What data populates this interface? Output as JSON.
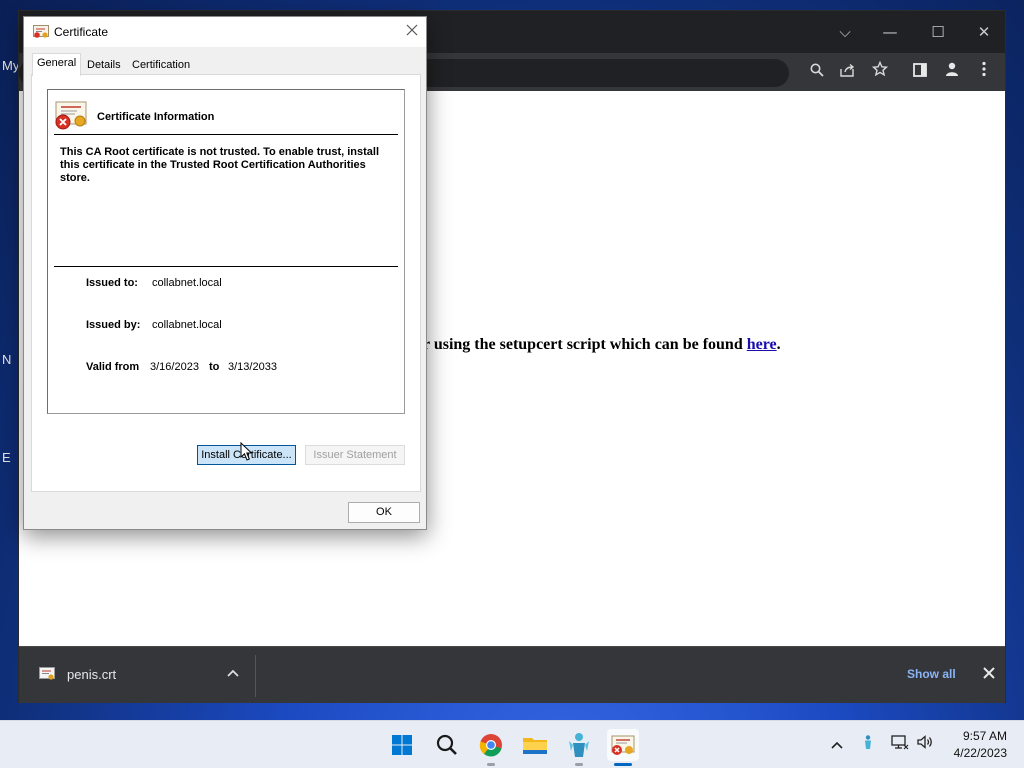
{
  "desktop": {
    "fragments": [
      "My",
      "N",
      "E"
    ],
    "icon_names": [
      "desktop-shortcut-icon",
      "desktop-shortcut-icon",
      "desktop-shortcut-icon",
      "desktop-shortcut-icon"
    ]
  },
  "browser": {
    "window_controls": {
      "tab_search": "⌵",
      "minimize": "—",
      "maximize": "☐",
      "close": "✕"
    },
    "toolbar_icons": [
      "search-icon",
      "share-icon",
      "star-icon",
      "side-panel-icon",
      "profile-icon",
      "menu-icon"
    ],
    "page": {
      "text_before_link": "r using the setupcert script which can be found ",
      "link_text": "here",
      "text_after_link": "."
    },
    "download_shelf": {
      "filename": "penis.crt",
      "show_all": "Show all"
    }
  },
  "dialog": {
    "title": "Certificate",
    "tabs": [
      {
        "label": "General",
        "active": true
      },
      {
        "label": "Details",
        "active": false
      },
      {
        "label": "Certification Path",
        "active": false
      }
    ],
    "heading": "Certificate Information",
    "warning": "This CA Root certificate is not trusted. To enable trust, install this certificate in the Trusted Root Certification Authorities store.",
    "issued_to_label": "Issued to:",
    "issued_to": "collabnet.local",
    "issued_by_label": "Issued by:",
    "issued_by": "collabnet.local",
    "valid_from_label": "Valid from",
    "valid_from": "3/16/2023",
    "to_label": "to",
    "valid_to": "3/13/2033",
    "install_button": "Install Certificate...",
    "issuer_statement_button": "Issuer Statement",
    "ok_button": "OK"
  },
  "taskbar": {
    "apps": [
      "start-icon",
      "search-icon",
      "chrome-icon",
      "file-explorer-icon",
      "network-app-icon",
      "certificate-icon"
    ],
    "tray_icons": [
      "chevron-up-icon",
      "network-app-tray-icon",
      "network-icon",
      "volume-icon"
    ],
    "time": "9:57 AM",
    "date": "4/22/2023"
  },
  "colors": {
    "accent_blue": "#0067c0",
    "link": "#1a0dab",
    "show_all": "#8ab4f8",
    "error_red": "#d93025"
  }
}
